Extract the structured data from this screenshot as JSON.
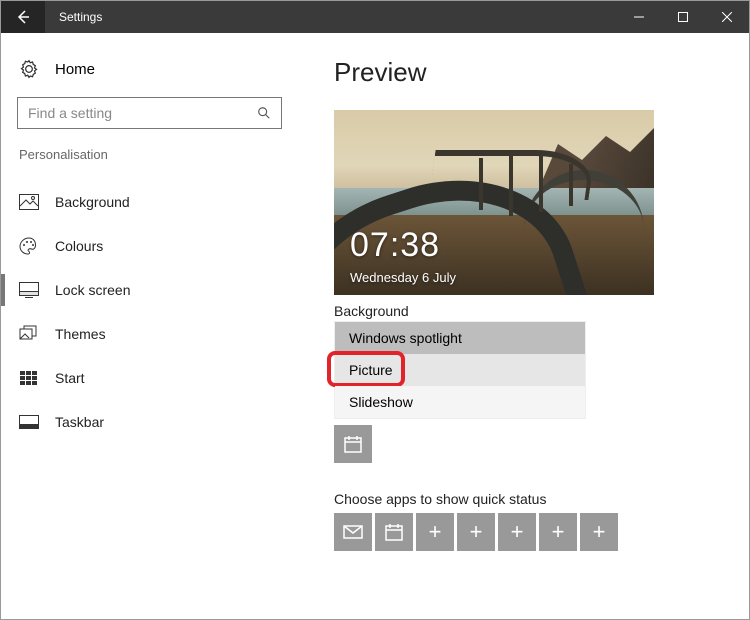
{
  "titlebar": {
    "title": "Settings"
  },
  "sidebar": {
    "home": "Home",
    "search_placeholder": "Find a setting",
    "section": "Personalisation",
    "items": [
      {
        "label": "Background"
      },
      {
        "label": "Colours"
      },
      {
        "label": "Lock screen"
      },
      {
        "label": "Themes"
      },
      {
        "label": "Start"
      },
      {
        "label": "Taskbar"
      }
    ]
  },
  "main": {
    "preview_heading": "Preview",
    "preview": {
      "time": "07:38",
      "date": "Wednesday 6 July"
    },
    "background_label": "Background",
    "dropdown": {
      "options": [
        {
          "label": "Windows spotlight"
        },
        {
          "label": "Picture"
        },
        {
          "label": "Slideshow"
        }
      ]
    },
    "quick_status_label": "Choose apps to show quick status"
  }
}
